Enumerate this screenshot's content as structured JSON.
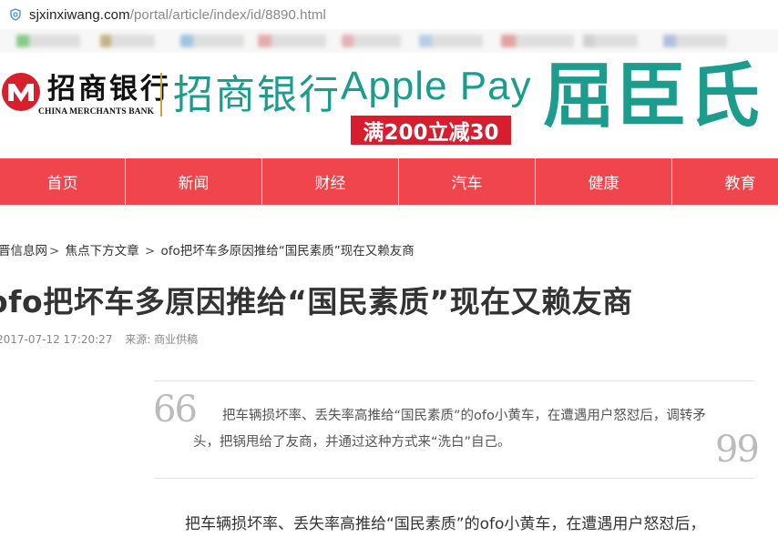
{
  "browser": {
    "url_domain": "sjxinxiwang.com",
    "url_path": "/portal/article/index/id/8890.html"
  },
  "bookmarks": [
    {
      "color": "#6fbf73"
    },
    {
      "color": "#b8a46a"
    },
    {
      "color": "#8bb9d8"
    },
    {
      "color": "#e09a9a"
    },
    {
      "color": "#e0a0a8"
    },
    {
      "color": "#a9c3e0"
    },
    {
      "color": "#e08c8c"
    },
    {
      "color": "#c6c6c6"
    },
    {
      "color": "#9fb3d6"
    }
  ],
  "banner": {
    "bank_name_cn": "招商银行",
    "bank_name_en": "CHINA MERCHANTS BANK",
    "ad_bank": "招商银行",
    "ad_product": "Apple Pay",
    "ad_promo": "满200立减30",
    "ad_store": "屈臣氏"
  },
  "nav": [
    "首页",
    "新闻",
    "财经",
    "汽车",
    "健康",
    "教育"
  ],
  "breadcrumb": {
    "home": "晋信息网",
    "category": "焦点下方文章",
    "current": "ofo把坏车多原因推给“国民素质”现在又赖友商"
  },
  "article": {
    "title": "ofo把坏车多原因推给“国民素质”现在又赖友商",
    "date": "2017-07-12 17:20:27",
    "source": "来源: 商业供稿",
    "quote": "把车辆损坏率、丢失率高推给“国民素质”的ofo小黄车，在遭遇用户怒怼后，调转矛头，把锅甩给了友商，并通过这种方式来“洗白”自己。",
    "paragraph": "把车辆损坏率、丢失率高推给“国民素质”的ofo小黄车，在遭遇用户怒怼后，"
  },
  "colors": {
    "nav_bg": "#f0454c",
    "ad_green": "#1b9c8c",
    "promo_red": "#d81e2e"
  },
  "icons": {
    "security": "shield-icon",
    "quote_open": "quote-open-icon",
    "quote_close": "quote-close-icon",
    "logo": "cmb-logo-icon"
  }
}
